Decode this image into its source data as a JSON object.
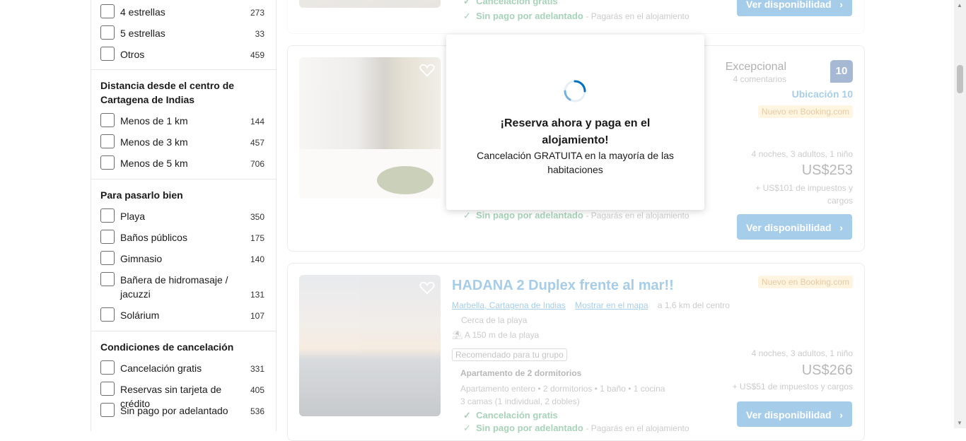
{
  "sidebar": {
    "stars": [
      {
        "label": "4 estrellas",
        "count": "273"
      },
      {
        "label": "5 estrellas",
        "count": "33"
      },
      {
        "label": "Otros",
        "count": "459"
      }
    ],
    "distance": {
      "title": "Distancia desde el centro de Cartagena de Indias",
      "options": [
        {
          "label": "Menos de 1 km",
          "count": "144"
        },
        {
          "label": "Menos de 3 km",
          "count": "457"
        },
        {
          "label": "Menos de 5 km",
          "count": "706"
        }
      ]
    },
    "fun": {
      "title": "Para pasarlo bien",
      "options": [
        {
          "label": "Playa",
          "count": "350"
        },
        {
          "label": "Baños públicos",
          "count": "175"
        },
        {
          "label": "Gimnasio",
          "count": "140"
        },
        {
          "label": "Bañera de hidromasaje / jacuzzi",
          "count": "131"
        },
        {
          "label": "Solárium",
          "count": "107"
        }
      ]
    },
    "cancel": {
      "title": "Condiciones de cancelación",
      "options": [
        {
          "label": "Cancelación gratis",
          "count": "331"
        },
        {
          "label": "Reservas sin tarjeta de crédito",
          "count": "405"
        },
        {
          "label": "Sin pago por adelantado",
          "count": "536"
        }
      ]
    }
  },
  "listings": {
    "first": {
      "free_cancel": "Cancelación gratis",
      "no_prepay": "Sin pago por adelantado",
      "pay_at_property": "- Pagarás en el alojamiento",
      "button": "Ver disponibilidad"
    },
    "second": {
      "rating_word": "Excepcional",
      "reviews": "4 comentarios",
      "score": "10",
      "location_score": "Ubicación 10",
      "new_badge": "Nuevo en Booking.com",
      "stay_info": "4 noches, 3 adultos, 1 niño",
      "price": "US$253",
      "taxes": "+ US$101 de impuestos y cargos",
      "no_prepay": "Sin pago por adelantado",
      "pay_at_property": "- Pagarás en el alojamiento",
      "button": "Ver disponibilidad"
    },
    "third": {
      "title": "HADANA 2 Duplex frente al mar!!",
      "location": "Marbella, Cartagena de Indias",
      "map_link": "Mostrar en el mapa",
      "distance": "a 1,6 km del centro",
      "near_beach": "Cerca de la playa",
      "beach_distance": "A 150 m de la playa",
      "group_tag": "Recomendado para tu grupo",
      "new_badge": "Nuevo en Booking.com",
      "unit_type": "Apartamento de 2 dormitorios",
      "unit_desc": "Apartamento entero • 2 dormitorios • 1 baño • 1 cocina",
      "beds": "3 camas (1 individual, 2 dobles)",
      "free_cancel": "Cancelación gratis",
      "no_prepay": "Sin pago por adelantado",
      "pay_at_property": "- Pagarás en el alojamiento",
      "stay_info": "4 noches, 3 adultos, 1 niño",
      "price": "US$266",
      "taxes": "+ US$51 de impuestos y cargos",
      "button": "Ver disponibilidad"
    }
  },
  "modal": {
    "title": "¡Reserva ahora y paga en el alojamiento!",
    "subtitle": "Cancelación GRATUITA en la mayoría de las habitaciones"
  },
  "colors": {
    "brand_blue": "#0071c2",
    "green": "#008234",
    "score_bg": "#003580"
  }
}
